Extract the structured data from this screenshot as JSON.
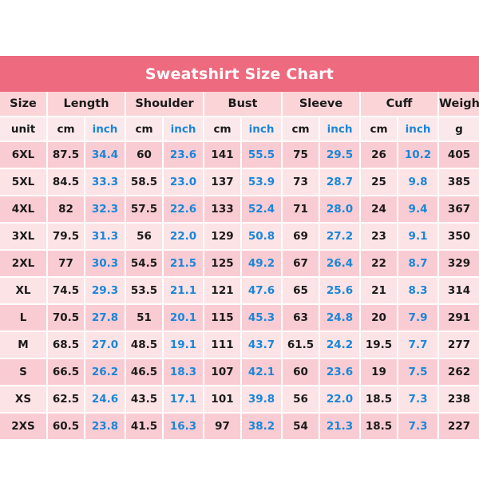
{
  "title": "Sweatshirt Size Chart",
  "colors": {
    "title_bar": "#ee6a7f",
    "title_text": "#ffffff",
    "header_row": "#fbd4d8",
    "unit_row": "#fbe8ea",
    "row_odd": "#f9ccd3",
    "row_even": "#fce3e6",
    "inch_text": "#1a86d8",
    "cm_text": "#1a1a1a",
    "grid_line": "#ffffff"
  },
  "group_headers": [
    {
      "label": "Size",
      "span": 1
    },
    {
      "label": "Length",
      "span": 2
    },
    {
      "label": "Shoulder",
      "span": 2
    },
    {
      "label": "Bust",
      "span": 2
    },
    {
      "label": "Sleeve",
      "span": 2
    },
    {
      "label": "Cuff",
      "span": 2
    },
    {
      "label": "Weight",
      "span": 1
    }
  ],
  "unit_row": [
    "unit",
    "cm",
    "inch",
    "cm",
    "inch",
    "cm",
    "inch",
    "cm",
    "inch",
    "cm",
    "inch",
    "g"
  ],
  "columns": [
    "Size",
    "Length cm",
    "Length inch",
    "Shoulder cm",
    "Shoulder inch",
    "Bust cm",
    "Bust inch",
    "Sleeve cm",
    "Sleeve inch",
    "Cuff cm",
    "Cuff inch",
    "Weight g"
  ],
  "rows": [
    {
      "size": "6XL",
      "length_cm": "87.5",
      "length_in": "34.4",
      "shoulder_cm": "60",
      "shoulder_in": "23.6",
      "bust_cm": "141",
      "bust_in": "55.5",
      "sleeve_cm": "75",
      "sleeve_in": "29.5",
      "cuff_cm": "26",
      "cuff_in": "10.2",
      "weight_g": "405"
    },
    {
      "size": "5XL",
      "length_cm": "84.5",
      "length_in": "33.3",
      "shoulder_cm": "58.5",
      "shoulder_in": "23.0",
      "bust_cm": "137",
      "bust_in": "53.9",
      "sleeve_cm": "73",
      "sleeve_in": "28.7",
      "cuff_cm": "25",
      "cuff_in": "9.8",
      "weight_g": "385"
    },
    {
      "size": "4XL",
      "length_cm": "82",
      "length_in": "32.3",
      "shoulder_cm": "57.5",
      "shoulder_in": "22.6",
      "bust_cm": "133",
      "bust_in": "52.4",
      "sleeve_cm": "71",
      "sleeve_in": "28.0",
      "cuff_cm": "24",
      "cuff_in": "9.4",
      "weight_g": "367"
    },
    {
      "size": "3XL",
      "length_cm": "79.5",
      "length_in": "31.3",
      "shoulder_cm": "56",
      "shoulder_in": "22.0",
      "bust_cm": "129",
      "bust_in": "50.8",
      "sleeve_cm": "69",
      "sleeve_in": "27.2",
      "cuff_cm": "23",
      "cuff_in": "9.1",
      "weight_g": "350"
    },
    {
      "size": "2XL",
      "length_cm": "77",
      "length_in": "30.3",
      "shoulder_cm": "54.5",
      "shoulder_in": "21.5",
      "bust_cm": "125",
      "bust_in": "49.2",
      "sleeve_cm": "67",
      "sleeve_in": "26.4",
      "cuff_cm": "22",
      "cuff_in": "8.7",
      "weight_g": "329"
    },
    {
      "size": "XL",
      "length_cm": "74.5",
      "length_in": "29.3",
      "shoulder_cm": "53.5",
      "shoulder_in": "21.1",
      "bust_cm": "121",
      "bust_in": "47.6",
      "sleeve_cm": "65",
      "sleeve_in": "25.6",
      "cuff_cm": "21",
      "cuff_in": "8.3",
      "weight_g": "314"
    },
    {
      "size": "L",
      "length_cm": "70.5",
      "length_in": "27.8",
      "shoulder_cm": "51",
      "shoulder_in": "20.1",
      "bust_cm": "115",
      "bust_in": "45.3",
      "sleeve_cm": "63",
      "sleeve_in": "24.8",
      "cuff_cm": "20",
      "cuff_in": "7.9",
      "weight_g": "291"
    },
    {
      "size": "M",
      "length_cm": "68.5",
      "length_in": "27.0",
      "shoulder_cm": "48.5",
      "shoulder_in": "19.1",
      "bust_cm": "111",
      "bust_in": "43.7",
      "sleeve_cm": "61.5",
      "sleeve_in": "24.2",
      "cuff_cm": "19.5",
      "cuff_in": "7.7",
      "weight_g": "277"
    },
    {
      "size": "S",
      "length_cm": "66.5",
      "length_in": "26.2",
      "shoulder_cm": "46.5",
      "shoulder_in": "18.3",
      "bust_cm": "107",
      "bust_in": "42.1",
      "sleeve_cm": "60",
      "sleeve_in": "23.6",
      "cuff_cm": "19",
      "cuff_in": "7.5",
      "weight_g": "262"
    },
    {
      "size": "XS",
      "length_cm": "62.5",
      "length_in": "24.6",
      "shoulder_cm": "43.5",
      "shoulder_in": "17.1",
      "bust_cm": "101",
      "bust_in": "39.8",
      "sleeve_cm": "56",
      "sleeve_in": "22.0",
      "cuff_cm": "18.5",
      "cuff_in": "7.3",
      "weight_g": "238"
    },
    {
      "size": "2XS",
      "length_cm": "60.5",
      "length_in": "23.8",
      "shoulder_cm": "41.5",
      "shoulder_in": "16.3",
      "bust_cm": "97",
      "bust_in": "38.2",
      "sleeve_cm": "54",
      "sleeve_in": "21.3",
      "cuff_cm": "18.5",
      "cuff_in": "7.3",
      "weight_g": "227"
    }
  ],
  "chart_data": {
    "type": "table",
    "title": "Sweatshirt Size Chart",
    "categories": [
      "6XL",
      "5XL",
      "4XL",
      "3XL",
      "2XL",
      "XL",
      "L",
      "M",
      "S",
      "XS",
      "2XS"
    ],
    "series": [
      {
        "name": "Length cm",
        "values": [
          87.5,
          84.5,
          82,
          79.5,
          77,
          74.5,
          70.5,
          68.5,
          66.5,
          62.5,
          60.5
        ]
      },
      {
        "name": "Length inch",
        "values": [
          34.4,
          33.3,
          32.3,
          31.3,
          30.3,
          29.3,
          27.8,
          27.0,
          26.2,
          24.6,
          23.8
        ]
      },
      {
        "name": "Shoulder cm",
        "values": [
          60,
          58.5,
          57.5,
          56,
          54.5,
          53.5,
          51,
          48.5,
          46.5,
          43.5,
          41.5
        ]
      },
      {
        "name": "Shoulder inch",
        "values": [
          23.6,
          23.0,
          22.6,
          22.0,
          21.5,
          21.1,
          20.1,
          19.1,
          18.3,
          17.1,
          16.3
        ]
      },
      {
        "name": "Bust cm",
        "values": [
          141,
          137,
          133,
          129,
          125,
          121,
          115,
          111,
          107,
          101,
          97
        ]
      },
      {
        "name": "Bust inch",
        "values": [
          55.5,
          53.9,
          52.4,
          50.8,
          49.2,
          47.6,
          45.3,
          43.7,
          42.1,
          39.8,
          38.2
        ]
      },
      {
        "name": "Sleeve cm",
        "values": [
          75,
          73,
          71,
          69,
          67,
          65,
          63,
          61.5,
          60,
          56,
          54
        ]
      },
      {
        "name": "Sleeve inch",
        "values": [
          29.5,
          28.7,
          28.0,
          27.2,
          26.4,
          25.6,
          24.8,
          24.2,
          23.6,
          22.0,
          21.3
        ]
      },
      {
        "name": "Cuff cm",
        "values": [
          26,
          25,
          24,
          23,
          22,
          21,
          20,
          19.5,
          19,
          18.5,
          18.5
        ]
      },
      {
        "name": "Cuff inch",
        "values": [
          10.2,
          9.8,
          9.4,
          9.1,
          8.7,
          8.3,
          7.9,
          7.7,
          7.5,
          7.3,
          7.3
        ]
      },
      {
        "name": "Weight g",
        "values": [
          405,
          385,
          367,
          350,
          329,
          314,
          291,
          277,
          262,
          238,
          227
        ]
      }
    ],
    "xlabel": "Size",
    "ylabel": ""
  }
}
